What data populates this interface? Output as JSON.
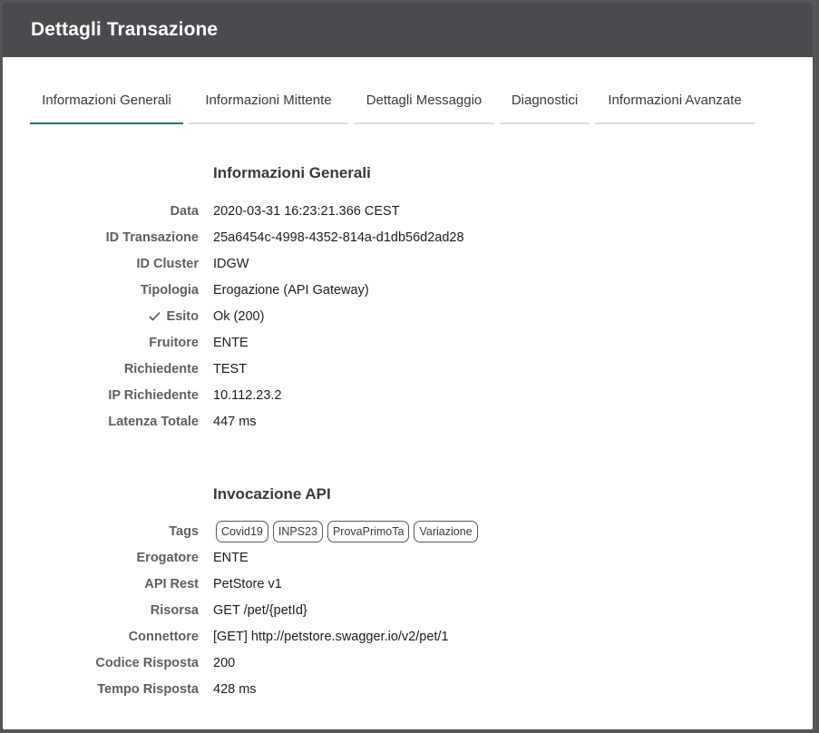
{
  "header": {
    "title": "Dettagli Transazione"
  },
  "tabs": [
    {
      "label": "Informazioni Generali",
      "active": true
    },
    {
      "label": "Informazioni Mittente",
      "active": false
    },
    {
      "label": "Dettagli Messaggio",
      "active": false
    },
    {
      "label": "Diagnostici",
      "active": false
    },
    {
      "label": "Informazioni Avanzate",
      "active": false
    }
  ],
  "general": {
    "title": "Informazioni Generali",
    "rows": [
      {
        "label": "Data",
        "value": "2020-03-31 16:23:21.366 CEST"
      },
      {
        "label": "ID Transazione",
        "value": "25a6454c-4998-4352-814a-d1db56d2ad28"
      },
      {
        "label": "ID Cluster",
        "value": "IDGW"
      },
      {
        "label": "Tipologia",
        "value": "Erogazione (API Gateway)"
      },
      {
        "label": "Esito",
        "value": "Ok (200)",
        "icon": "check-icon"
      },
      {
        "label": "Fruitore",
        "value": "ENTE"
      },
      {
        "label": "Richiedente",
        "value": "TEST"
      },
      {
        "label": "IP Richiedente",
        "value": "10.112.23.2"
      },
      {
        "label": "Latenza Totale",
        "value": "447 ms"
      }
    ]
  },
  "invocation": {
    "title": "Invocazione API",
    "tags_label": "Tags",
    "tags": [
      "Covid19",
      "INPS23",
      "ProvaPrimoTa",
      "Variazione"
    ],
    "rows": [
      {
        "label": "Erogatore",
        "value": "ENTE"
      },
      {
        "label": "API Rest",
        "value": "PetStore v1"
      },
      {
        "label": "Risorsa",
        "value": "GET /pet/{petId}"
      },
      {
        "label": "Connettore",
        "value": "[GET] http://petstore.swagger.io/v2/pet/1"
      },
      {
        "label": "Codice Risposta",
        "value": "200"
      },
      {
        "label": "Tempo Risposta",
        "value": "428 ms"
      }
    ]
  },
  "colors": {
    "header_bg": "#4a4b4f",
    "active_tab": "#1f7a6e"
  }
}
